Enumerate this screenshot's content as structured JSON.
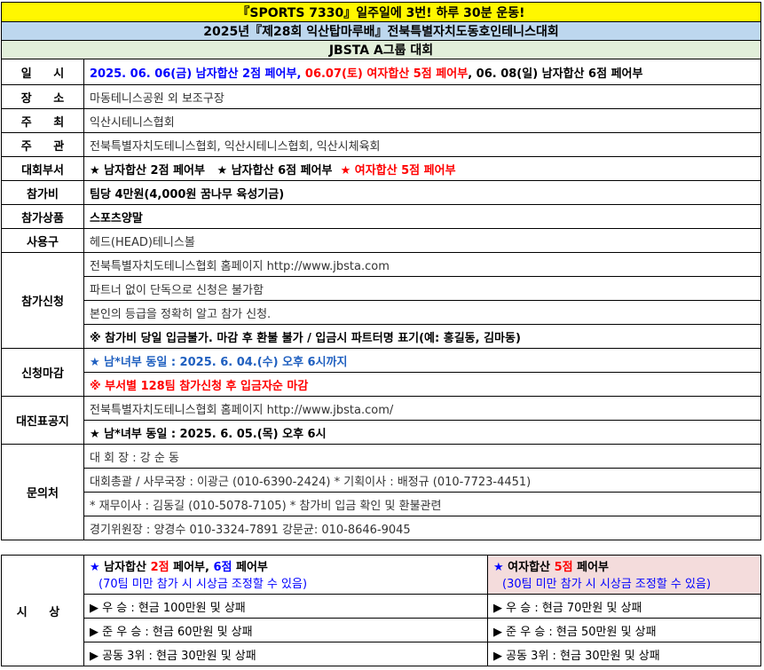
{
  "banner": {
    "slogan": "『SPORTS 7330』일주일에 3번! 하루 30분 운동!",
    "title": "2025년『제28회 익산탑마루배』전북특별자치도동호인테니스대회",
    "subtitle": "JBSTA   A그룹 대회"
  },
  "rows": {
    "date": {
      "label": "일 시",
      "p1": "2025. 06. 06(금) 남자합산 2점 페어부, ",
      "p2": "06.07(토) 여자합산 5점 페어부",
      "p3": ", 06. 08(일) 남자합산 6점 페어부"
    },
    "venue": {
      "label": "장 소",
      "value": "마동테니스공원 외 보조구장"
    },
    "host": {
      "label": "주 최",
      "value": "익산시테니스협회"
    },
    "organizer": {
      "label": "주 관",
      "value": "전북특별자치도테니스협회, 익산시테니스협회, 익산시체육회"
    },
    "divisions": {
      "label": "대회부서",
      "d1": "★ 남자합산 2점 페어부",
      "d2": "★ 남자합산 6점 페어부",
      "d3_star": "★",
      "d3": " 여자합산 5점 페어부"
    },
    "fee": {
      "label": "참가비",
      "value": "팀당 4만원(4,000원 꿈나무 육성기금)"
    },
    "gift": {
      "label": "참가상품",
      "value": "스포츠양말"
    },
    "ball": {
      "label": "사용구",
      "value": "헤드(HEAD)테니스볼"
    },
    "apply": {
      "label": "참가신청",
      "l1": "전북특별자치도테니스협회 홈페이지 http://www.jbsta.com",
      "l2": "파트너 없이 단독으로 신청은 불가함",
      "l3": "본인의 등급을 정확히 알고 참가 신청.",
      "l4": "※ 참가비 당일 입금불가. 마감 후 환불 불가 / 입금시 파트터명 표기(예: 홍길동, 김마동)"
    },
    "deadline": {
      "label": "신청마감",
      "l1": "★ 남*녀부 동일 : 2025. 6. 04.(수) 오후 6시까지",
      "l2": "※ 부서별 128팀 참가신청 후 입금자순 마감"
    },
    "bracket": {
      "label": "대진표공지",
      "l1": "전북특별자치도테니스협회 홈페이지 http://www.jbsta.com/",
      "l2": "★ 남*녀부 동일 : 2025. 6. 05.(목) 오후 6시"
    },
    "contact": {
      "label": "문의처",
      "l1": "대 회 장 : 강 순 동",
      "l2": "대회총괄 / 사무국장 : 이광근 (010-6390-2424)  * 기획이사 : 배정규 (010-7723-4451)",
      "l3": "* 재무이사 : 김동길 (010-5078-7105)  * 참가비 입금 확인 및 환불관련",
      "l4": "경기위원장 : 양경수 010-3324-7891    강문균: 010-8646-9045"
    }
  },
  "prize": {
    "label": "시 상",
    "men": {
      "star": "★",
      "t1": " 남자합산 ",
      "t2": "2점",
      "t3": " 페어부, ",
      "t4": "6점",
      "t5": " 페어부",
      "note": "(70팀 미만 참가 시 시상금 조정할 수 있음)",
      "winner": "▶ 우    승 :  현금 100만원 및 상패",
      "runner": "▶ 준 우 승 :  현금  60만원 및 상패",
      "third": "▶ 공동 3위 : 현금  30만원 및 상패"
    },
    "women": {
      "star": "★",
      "t1": " 여자합산 ",
      "t2": "5점",
      "t3": " 페어부",
      "note": "(30팀 미만 참가 시 시상금 조정할 수 있음)",
      "winner": "▶ 우     승 :   현금 70만원 및 상패",
      "runner": "▶ 준 우 승 :   현금 50만원 및 상패",
      "third": "▶ 공동 3위 :  현금 30만원 및 상패"
    }
  }
}
